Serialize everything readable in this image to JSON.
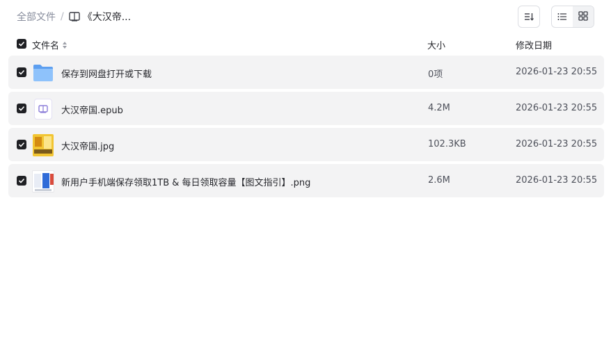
{
  "breadcrumb": {
    "root": "全部文件",
    "separator": "/",
    "current": "《大汉帝..."
  },
  "toolbar": {
    "sort_icon": "sort-lines-icon",
    "list_view_icon": "list-view-icon",
    "grid_view_icon": "grid-view-icon",
    "active_view": "list"
  },
  "table": {
    "columns": {
      "name": "文件名",
      "size": "大小",
      "date": "修改日期"
    },
    "rows": [
      {
        "icon": "folder-icon",
        "name": "保存到网盘打开或下载",
        "size": "0项",
        "date": "2026-01-23 20:55",
        "checked": true
      },
      {
        "icon": "epub-book-icon",
        "name": "大汉帝国.epub",
        "size": "4.2M",
        "date": "2026-01-23 20:55",
        "checked": true
      },
      {
        "icon": "image-thumbnail",
        "name": "大汉帝国.jpg",
        "size": "102.3KB",
        "date": "2026-01-23 20:55",
        "checked": true
      },
      {
        "icon": "image-thumbnail",
        "name": "新用户手机端保存领取1TB & 每日领取容量【图文指引】.png",
        "size": "2.6M",
        "date": "2026-01-23 20:55",
        "checked": true
      }
    ]
  },
  "colors": {
    "checkbox": "#1f2024",
    "row_bg": "#f3f3f4",
    "folder": "#6aaef5",
    "epub_accent": "#8a7cd8"
  }
}
